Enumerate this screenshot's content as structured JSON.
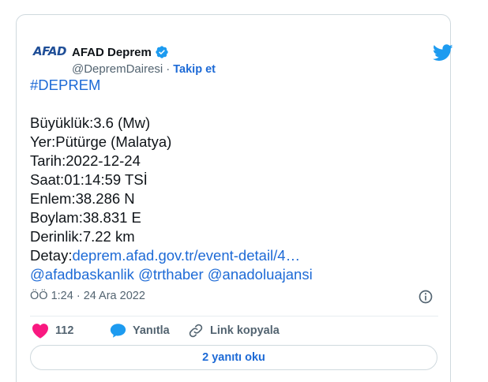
{
  "account": {
    "logo_text": "AFAD",
    "display_name": "AFAD Deprem",
    "handle": "@DepremDairesi",
    "separator": "·",
    "follow_label": "Takip et"
  },
  "tweet": {
    "hashtag": "#DEPREM",
    "magnitude": "Büyüklük:3.6 (Mw)",
    "location": "Yer:Pütürge (Malatya)",
    "date": "Tarih:2022-12-24",
    "time": "Saat:01:14:59 TSİ",
    "latitude": "Enlem:38.286 N",
    "longitude": "Boylam:38.831 E",
    "depth": "Derinlik:7.22 km",
    "detail_label": "Detay:",
    "detail_link": "deprem.afad.gov.tr/event-detail/4…",
    "mentions": [
      "@afadbaskanlik",
      "@trthaber",
      "@anadoluajansi"
    ]
  },
  "meta": {
    "timestamp": "ÖÖ 1:24 · 24 Ara 2022"
  },
  "actions": {
    "like_count": "112",
    "reply_label": "Yanıtla",
    "copy_link_label": "Link kopyala",
    "read_replies_label": "2 yanıtı oku"
  },
  "colors": {
    "link": "#1d6ad6",
    "heart": "#f91880",
    "twitter_blue": "#1d9bf0",
    "verified": "#1d9bf0",
    "border": "#cfd9de"
  }
}
